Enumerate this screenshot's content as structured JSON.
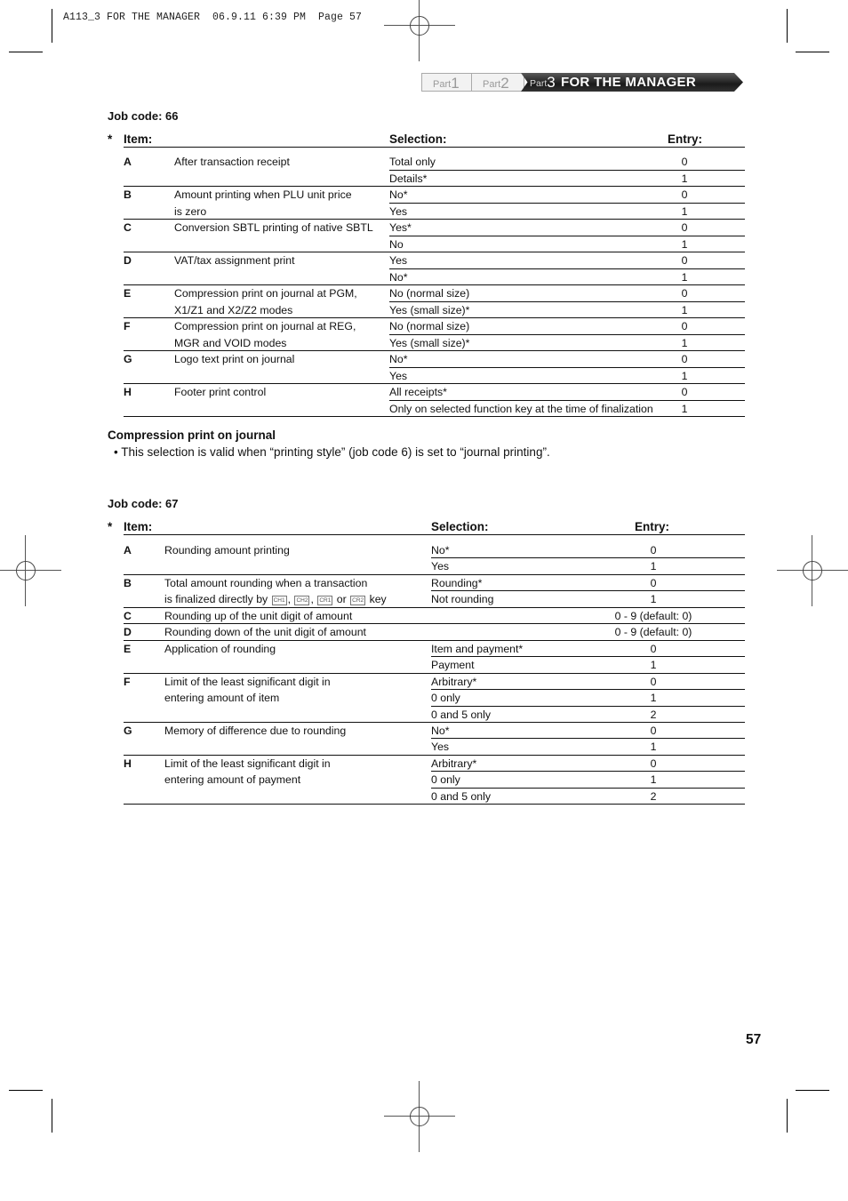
{
  "slug": "A113_3 FOR THE MANAGER  06.9.11 6:39 PM  Page 57",
  "banner": {
    "tabs": [
      {
        "prefix": "Part",
        "number": "1"
      },
      {
        "prefix": "Part",
        "number": "2"
      },
      {
        "prefix": "Part",
        "number": "3",
        "title": "FOR THE MANAGER",
        "active": true
      }
    ]
  },
  "job66": {
    "heading": "Job code:  66",
    "star": "*",
    "headers": {
      "item": "Item:",
      "selection": "Selection:",
      "entry": "Entry:"
    },
    "items": [
      {
        "letter": "A",
        "text": [
          "After transaction receipt"
        ],
        "options": [
          {
            "selection": "Total only",
            "entry": "0"
          },
          {
            "selection": "Details*",
            "entry": "1"
          }
        ]
      },
      {
        "letter": "B",
        "text": [
          "Amount printing when PLU unit price",
          "is zero"
        ],
        "options": [
          {
            "selection": "No*",
            "entry": "0"
          },
          {
            "selection": "Yes",
            "entry": "1"
          }
        ]
      },
      {
        "letter": "C",
        "text": [
          "Conversion SBTL printing of native SBTL"
        ],
        "options": [
          {
            "selection": "Yes*",
            "entry": "0"
          },
          {
            "selection": "No",
            "entry": "1"
          }
        ]
      },
      {
        "letter": "D",
        "text": [
          "VAT/tax assignment print"
        ],
        "options": [
          {
            "selection": "Yes",
            "entry": "0"
          },
          {
            "selection": "No*",
            "entry": "1"
          }
        ]
      },
      {
        "letter": "E",
        "text": [
          "Compression print on journal at PGM,",
          "X1/Z1 and X2/Z2 modes"
        ],
        "options": [
          {
            "selection": "No (normal size)",
            "entry": "0"
          },
          {
            "selection": "Yes (small size)*",
            "entry": "1"
          }
        ]
      },
      {
        "letter": "F",
        "text": [
          "Compression print on journal at REG,",
          "MGR and VOID modes"
        ],
        "options": [
          {
            "selection": "No (normal size)",
            "entry": "0"
          },
          {
            "selection": "Yes (small size)*",
            "entry": "1"
          }
        ]
      },
      {
        "letter": "G",
        "text": [
          "Logo text print on journal"
        ],
        "options": [
          {
            "selection": "No*",
            "entry": "0"
          },
          {
            "selection": "Yes",
            "entry": "1"
          }
        ]
      },
      {
        "letter": "H",
        "text": [
          "Footer print control"
        ],
        "options": [
          {
            "selection": "All receipts*",
            "entry": "0"
          },
          {
            "selection": "Only on selected function key at the time of finalization",
            "entry": "1"
          }
        ]
      }
    ]
  },
  "note": {
    "title": "Compression print on journal",
    "text": "• This selection is valid when “printing style” (job code 6) is set to “journal printing”."
  },
  "job67": {
    "heading": "Job code:  67",
    "star": "*",
    "headers": {
      "item": "Item:",
      "selection": "Selection:",
      "entry": "Entry:"
    },
    "items": [
      {
        "letter": "A",
        "text": [
          "Rounding amount printing"
        ],
        "options": [
          {
            "selection": "No*",
            "entry": "0"
          },
          {
            "selection": "Yes",
            "entry": "1"
          }
        ]
      },
      {
        "letter": "B",
        "text": [
          "Total amount rounding when a transaction",
          "is finalized directly by"
        ],
        "keys": [
          "CH1",
          "CH2",
          "CR1",
          "CR2"
        ],
        "key_suffix": "key",
        "key_or": "or",
        "options": [
          {
            "selection": "Rounding*",
            "entry": "0"
          },
          {
            "selection": "Not rounding",
            "entry": "1"
          }
        ]
      },
      {
        "letter": "C",
        "text": [
          "Rounding up of the unit digit of amount"
        ],
        "options": [
          {
            "selection": "",
            "entry": "0 - 9 (default: 0)"
          }
        ]
      },
      {
        "letter": "D",
        "text": [
          "Rounding down of the unit digit of amount"
        ],
        "options": [
          {
            "selection": "",
            "entry": "0 - 9 (default: 0)"
          }
        ]
      },
      {
        "letter": "E",
        "text": [
          "Application of rounding"
        ],
        "options": [
          {
            "selection": "Item and payment*",
            "entry": "0"
          },
          {
            "selection": "Payment",
            "entry": "1"
          }
        ]
      },
      {
        "letter": "F",
        "text": [
          "Limit of the least significant digit in",
          "entering amount of item"
        ],
        "options": [
          {
            "selection": "Arbitrary*",
            "entry": "0"
          },
          {
            "selection": "0 only",
            "entry": "1"
          },
          {
            "selection": "0 and 5 only",
            "entry": "2"
          }
        ]
      },
      {
        "letter": "G",
        "text": [
          "Memory of difference due to rounding"
        ],
        "options": [
          {
            "selection": "No*",
            "entry": "0"
          },
          {
            "selection": "Yes",
            "entry": "1"
          }
        ]
      },
      {
        "letter": "H",
        "text": [
          "Limit of the least significant digit in",
          "entering amount of payment"
        ],
        "options": [
          {
            "selection": "Arbitrary*",
            "entry": "0"
          },
          {
            "selection": "0 only",
            "entry": "1"
          },
          {
            "selection": "0 and 5 only",
            "entry": "2"
          }
        ]
      }
    ]
  },
  "page_number": "57"
}
